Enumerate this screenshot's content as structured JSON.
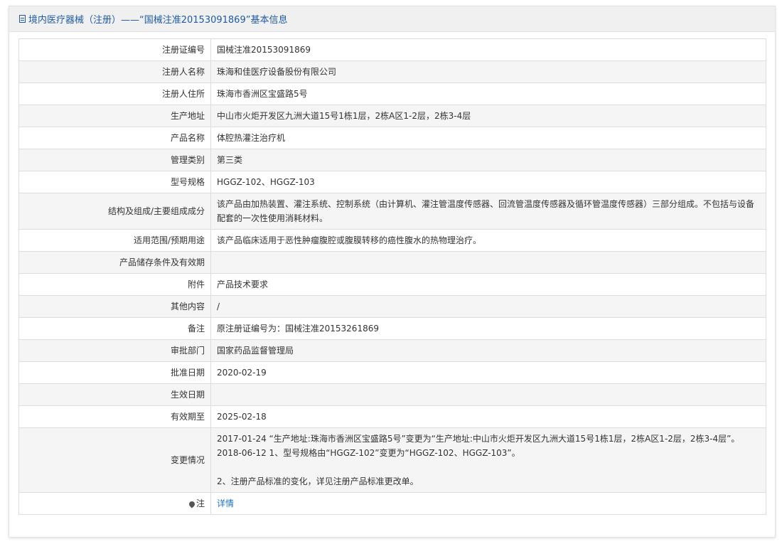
{
  "header": {
    "title": "境内医疗器械（注册）——“国械注准20153091869”基本信息"
  },
  "rows": [
    {
      "label": "注册证编号",
      "value": "国械注准20153091869"
    },
    {
      "label": "注册人名称",
      "value": "珠海和佳医疗设备股份有限公司"
    },
    {
      "label": "注册人住所",
      "value": "珠海市香洲区宝盛路5号"
    },
    {
      "label": "生产地址",
      "value": "中山市火炬开发区九洲大道15号1栋1层，2栋A区1-2层，2栋3-4层"
    },
    {
      "label": "产品名称",
      "value": "体腔热灌注治疗机"
    },
    {
      "label": "管理类别",
      "value": "第三类"
    },
    {
      "label": "型号规格",
      "value": "HGGZ-102、HGGZ-103"
    },
    {
      "label": "结构及组成/主要组成成分",
      "value": "该产品由加热装置、灌注系统、控制系统（由计算机、灌注管温度传感器、回流管温度传感器及循环管温度传感器）三部分组成。不包括与设备配套的一次性使用消耗材料。"
    },
    {
      "label": "适用范围/预期用途",
      "value": "该产品临床适用于恶性肿瘤腹腔或腹膜转移的癌性腹水的热物理治疗。"
    },
    {
      "label": "产品储存条件及有效期",
      "value": ""
    },
    {
      "label": "附件",
      "value": "产品技术要求"
    },
    {
      "label": "其他内容",
      "value": "/"
    },
    {
      "label": "备注",
      "value": "原注册证编号为：国械注准20153261869"
    },
    {
      "label": "审批部门",
      "value": "国家药品监督管理局"
    },
    {
      "label": "批准日期",
      "value": "2020-02-19"
    },
    {
      "label": "生效日期",
      "value": ""
    },
    {
      "label": "有效期至",
      "value": "2025-02-18"
    },
    {
      "label": "变更情况",
      "value": "2017-01-24 “生产地址:珠海市香洲区宝盛路5号”变更为“生产地址:中山市火炬开发区九洲大道15号1栋1层，2栋A区1-2层，2栋3-4层”。\n2018-06-12 1、型号规格由“HGGZ-102”变更为“HGGZ-102、HGGZ-103”。\n\n2、注册产品标准的变化，详见注册产品标准更改单。"
    }
  ],
  "note": {
    "label": "注",
    "link_text": "详情"
  }
}
